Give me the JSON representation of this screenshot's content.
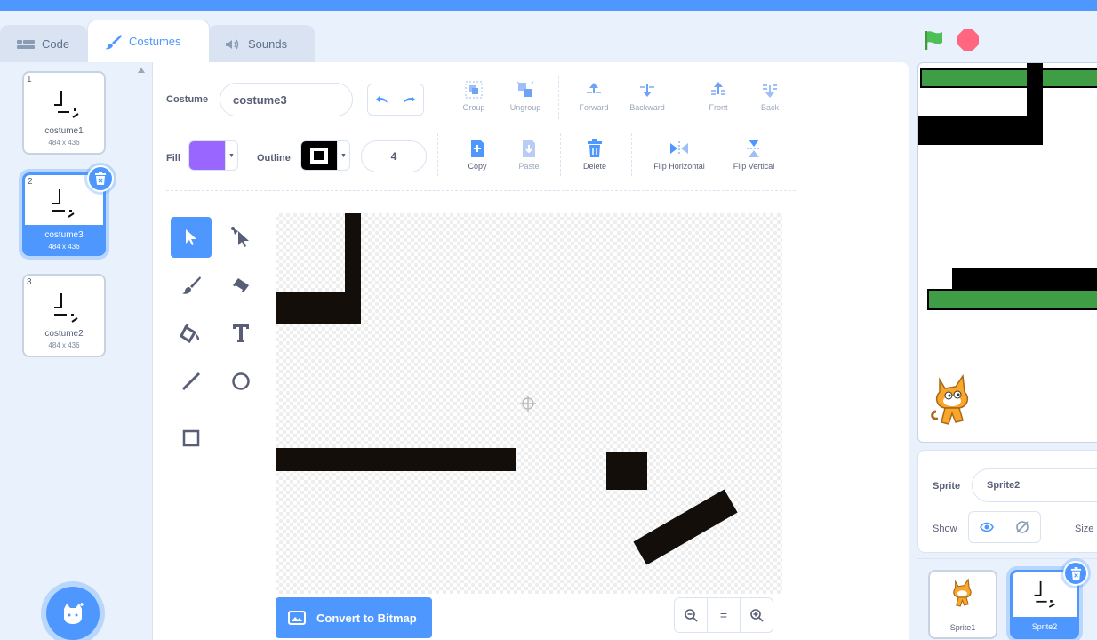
{
  "tabs": [
    {
      "label": "Code",
      "icon": "code-icon"
    },
    {
      "label": "Costumes",
      "icon": "brush-icon"
    },
    {
      "label": "Sounds",
      "icon": "speaker-icon"
    }
  ],
  "costumes": [
    {
      "num": "1",
      "name": "costume1",
      "size": "484 x 436"
    },
    {
      "num": "2",
      "name": "costume3",
      "size": "484 x 436",
      "selected": true
    },
    {
      "num": "3",
      "name": "costume2",
      "size": "484 x 436"
    }
  ],
  "editor": {
    "costume_label": "Costume",
    "costume_name": "costume3",
    "fill_label": "Fill",
    "fill_color": "#9966ff",
    "outline_label": "Outline",
    "outline_color": "#000000",
    "outline_width": "4",
    "top_tools": [
      "Group",
      "Ungroup",
      "Forward",
      "Backward",
      "Front",
      "Back"
    ],
    "bottom_tools": [
      "Copy",
      "Paste",
      "Delete",
      "Flip Horizontal",
      "Flip Vertical"
    ],
    "convert_label": "Convert to Bitmap",
    "zoom_reset": "="
  },
  "sprite_info": {
    "sprite_label": "Sprite",
    "sprite_name": "Sprite2",
    "show_label": "Show",
    "size_label": "Size"
  },
  "sprites": [
    {
      "name": "Sprite1"
    },
    {
      "name": "Sprite2",
      "selected": true
    }
  ],
  "colors": {
    "accent": "#4d97ff",
    "stage_green": "#3f9e45",
    "shape": "#140e0a"
  }
}
